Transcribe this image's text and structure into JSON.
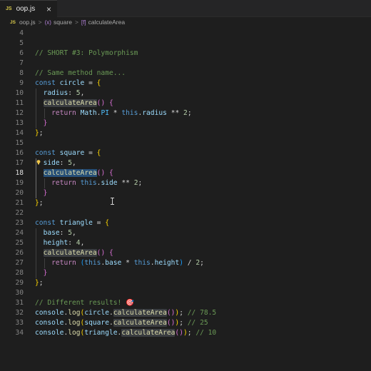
{
  "tab": {
    "badge": "JS",
    "filename": "oop.js",
    "close": "×"
  },
  "breadcrumb": {
    "badge": "JS",
    "file": "oop.js",
    "separator": ">",
    "symbol_icon": "(x)",
    "symbol": "square",
    "function_icon": "[f]",
    "function": "calculateArea"
  },
  "editor": {
    "active_line": 18,
    "lines": [
      {
        "n": "4",
        "code": ""
      },
      {
        "n": "5",
        "code": ""
      },
      {
        "n": "6",
        "code": "// SHORT #3: Polymorphism"
      },
      {
        "n": "7",
        "code": ""
      },
      {
        "n": "8",
        "code": "// Same method name..."
      },
      {
        "n": "9",
        "code": "const circle = {"
      },
      {
        "n": "10",
        "code": "  radius: 5,"
      },
      {
        "n": "11",
        "code": "  calculateArea() {"
      },
      {
        "n": "12",
        "code": "    return Math.PI * this.radius ** 2;"
      },
      {
        "n": "13",
        "code": "  }"
      },
      {
        "n": "14",
        "code": "};"
      },
      {
        "n": "15",
        "code": ""
      },
      {
        "n": "16",
        "code": "const square = {"
      },
      {
        "n": "17",
        "code": "  side: 5,"
      },
      {
        "n": "18",
        "code": "  calculateArea() {"
      },
      {
        "n": "19",
        "code": "    return this.side ** 2;"
      },
      {
        "n": "20",
        "code": "  }"
      },
      {
        "n": "21",
        "code": "};"
      },
      {
        "n": "22",
        "code": ""
      },
      {
        "n": "23",
        "code": "const triangle = {"
      },
      {
        "n": "24",
        "code": "  base: 5,"
      },
      {
        "n": "25",
        "code": "  height: 4,"
      },
      {
        "n": "26",
        "code": "  calculateArea() {"
      },
      {
        "n": "27",
        "code": "    return (this.base * this.height) / 2;"
      },
      {
        "n": "28",
        "code": "  }"
      },
      {
        "n": "29",
        "code": "};"
      },
      {
        "n": "30",
        "code": ""
      },
      {
        "n": "31",
        "code": "// Different results! 🎯"
      },
      {
        "n": "32",
        "code": "console.log(circle.calculateArea()); // 78.5"
      },
      {
        "n": "33",
        "code": "console.log(square.calculateArea()); // 25"
      },
      {
        "n": "34",
        "code": "console.log(triangle.calculateArea()); // 10"
      }
    ]
  },
  "colors": {
    "background": "#1e1e1e",
    "keyword": "#569cd6",
    "property": "#9cdcfe",
    "function": "#dcdcaa",
    "number": "#b5cea8",
    "comment": "#6a9955",
    "control": "#c586c0",
    "bracket_gold": "#ffd700",
    "bracket_purple": "#da70d6",
    "bracket_blue": "#179fff"
  },
  "icons": [
    "js-file-icon",
    "close-icon",
    "variable-symbol-icon",
    "function-symbol-icon",
    "lightbulb-icon",
    "text-cursor-icon"
  ]
}
